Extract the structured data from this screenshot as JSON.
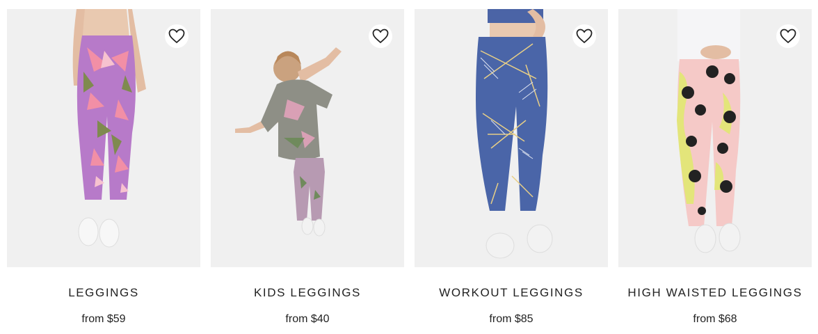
{
  "products": [
    {
      "title": "LEGGINGS",
      "price": "from $59",
      "icon": "heart-outline-icon"
    },
    {
      "title": "KIDS LEGGINGS",
      "price": "from $40",
      "icon": "heart-outline-icon"
    },
    {
      "title": "WORKOUT LEGGINGS",
      "price": "from $85",
      "icon": "heart-outline-icon"
    },
    {
      "title": "HIGH WAISTED LEGGINGS",
      "price": "from $68",
      "icon": "heart-outline-icon"
    }
  ],
  "colors": {
    "card_bg": "#f0f0f0",
    "text": "#222222"
  }
}
